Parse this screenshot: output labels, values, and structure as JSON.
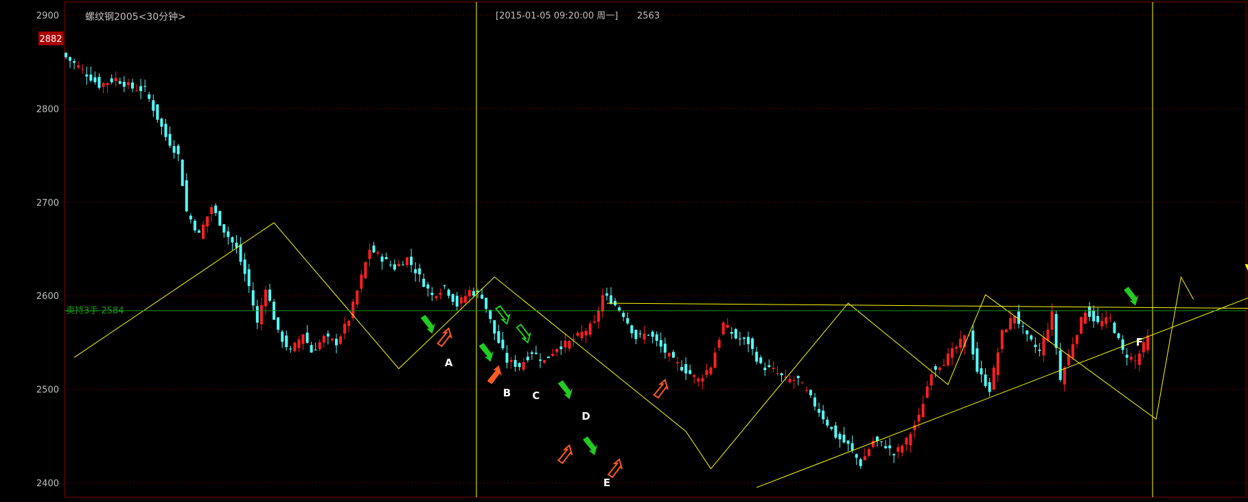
{
  "chart_title": "螺纹钢2005<30分钟>",
  "cursor_info": {
    "datetime": "[2015-01-05  09:20:00 周一]",
    "value": "2563"
  },
  "current_price_tag": "2882",
  "order_line": {
    "label": "卖持3手 2584",
    "price": 2584
  },
  "colors": {
    "background": "#000000",
    "up": "#ff2020",
    "down": "#54ffff",
    "axis": "#800000",
    "text": "#c0c0c0",
    "trend": "#ffff00",
    "order_line": "#1a9a1a",
    "tag_bg": "#aa0000",
    "arrow_green": "#22cc22",
    "arrow_orange": "#ff5a1f"
  },
  "chart_data": {
    "type": "candlestick",
    "yaxis": {
      "ticks": [
        2900,
        2800,
        2700,
        2600,
        2500,
        2400
      ],
      "ylim": [
        2390,
        2915
      ]
    },
    "x_bars": 262,
    "close_anchors": [
      [
        0,
        2855
      ],
      [
        3,
        2845
      ],
      [
        8,
        2825
      ],
      [
        12,
        2832
      ],
      [
        16,
        2822
      ],
      [
        19,
        2820
      ],
      [
        22,
        2790
      ],
      [
        24,
        2770
      ],
      [
        27,
        2750
      ],
      [
        29,
        2690
      ],
      [
        32,
        2665
      ],
      [
        35,
        2695
      ],
      [
        38,
        2670
      ],
      [
        41,
        2650
      ],
      [
        44,
        2610
      ],
      [
        46,
        2570
      ],
      [
        48,
        2610
      ],
      [
        51,
        2560
      ],
      [
        54,
        2540
      ],
      [
        57,
        2560
      ],
      [
        59,
        2540
      ],
      [
        62,
        2555
      ],
      [
        65,
        2550
      ],
      [
        68,
        2575
      ],
      [
        71,
        2620
      ],
      [
        73,
        2650
      ],
      [
        76,
        2640
      ],
      [
        79,
        2630
      ],
      [
        82,
        2640
      ],
      [
        85,
        2620
      ],
      [
        88,
        2600
      ],
      [
        91,
        2610
      ],
      [
        94,
        2590
      ],
      [
        97,
        2605
      ],
      [
        100,
        2600
      ],
      [
        103,
        2560
      ],
      [
        106,
        2530
      ],
      [
        109,
        2525
      ],
      [
        112,
        2540
      ],
      [
        115,
        2530
      ],
      [
        118,
        2545
      ],
      [
        121,
        2550
      ],
      [
        124,
        2560
      ],
      [
        127,
        2570
      ],
      [
        129,
        2600
      ],
      [
        131,
        2595
      ],
      [
        134,
        2580
      ],
      [
        137,
        2555
      ],
      [
        140,
        2560
      ],
      [
        143,
        2545
      ],
      [
        146,
        2530
      ],
      [
        149,
        2520
      ],
      [
        152,
        2510
      ],
      [
        155,
        2525
      ],
      [
        158,
        2570
      ],
      [
        161,
        2555
      ],
      [
        164,
        2550
      ],
      [
        167,
        2525
      ],
      [
        170,
        2520
      ],
      [
        173,
        2510
      ],
      [
        176,
        2510
      ],
      [
        179,
        2490
      ],
      [
        182,
        2470
      ],
      [
        185,
        2450
      ],
      [
        188,
        2440
      ],
      [
        191,
        2420
      ],
      [
        194,
        2445
      ],
      [
        197,
        2440
      ],
      [
        199,
        2430
      ],
      [
        202,
        2445
      ],
      [
        205,
        2470
      ],
      [
        208,
        2520
      ],
      [
        211,
        2530
      ],
      [
        214,
        2545
      ],
      [
        217,
        2560
      ],
      [
        219,
        2520
      ],
      [
        222,
        2500
      ],
      [
        225,
        2560
      ],
      [
        228,
        2580
      ],
      [
        231,
        2555
      ],
      [
        234,
        2540
      ],
      [
        237,
        2580
      ],
      [
        239,
        2510
      ],
      [
        242,
        2550
      ],
      [
        245,
        2585
      ],
      [
        248,
        2570
      ],
      [
        251,
        2575
      ],
      [
        254,
        2540
      ],
      [
        257,
        2530
      ],
      [
        260,
        2555
      ]
    ],
    "trend_lines": [
      [
        [
          2,
          2534
        ],
        [
          50,
          2678
        ],
        [
          80,
          2522
        ],
        [
          103,
          2620
        ],
        [
          149,
          2455
        ],
        [
          155,
          2415
        ],
        [
          188,
          2592
        ],
        [
          212,
          2505
        ],
        [
          221,
          2601
        ],
        [
          262,
          2468
        ],
        [
          268,
          2620
        ],
        [
          271,
          2596
        ]
      ],
      [
        [
          166,
          2395
        ],
        [
          310,
          2642
        ]
      ],
      [
        [
          130,
          2592
        ],
        [
          300,
          2586
        ]
      ]
    ],
    "annotations": [
      {
        "label": "A",
        "bar": 92,
        "price": 2545
      },
      {
        "label": "B",
        "bar": 106,
        "price": 2513
      },
      {
        "label": "C",
        "bar": 113,
        "price": 2510
      },
      {
        "label": "D",
        "bar": 125,
        "price": 2488
      },
      {
        "label": "E",
        "bar": 130,
        "price": 2417
      },
      {
        "label": "F",
        "bar": 258,
        "price": 2567
      }
    ],
    "arrows": [
      {
        "bar": 88,
        "price": 2560,
        "dir": "down",
        "color": "green",
        "filled": true
      },
      {
        "bar": 92,
        "price": 2565,
        "dir": "up",
        "color": "orange",
        "filled": false
      },
      {
        "bar": 102,
        "price": 2530,
        "dir": "down",
        "color": "green",
        "filled": true
      },
      {
        "bar": 104,
        "price": 2525,
        "dir": "up",
        "color": "orange",
        "filled": true
      },
      {
        "bar": 106,
        "price": 2570,
        "dir": "down",
        "color": "green",
        "filled": false
      },
      {
        "bar": 111,
        "price": 2550,
        "dir": "down",
        "color": "green",
        "filled": false
      },
      {
        "bar": 121,
        "price": 2490,
        "dir": "down",
        "color": "green",
        "filled": true
      },
      {
        "bar": 121,
        "price": 2440,
        "dir": "up",
        "color": "orange",
        "filled": false
      },
      {
        "bar": 127,
        "price": 2430,
        "dir": "down",
        "color": "green",
        "filled": true
      },
      {
        "bar": 133,
        "price": 2425,
        "dir": "up",
        "color": "orange",
        "filled": false
      },
      {
        "bar": 144,
        "price": 2510,
        "dir": "up",
        "color": "orange",
        "filled": false
      },
      {
        "bar": 257,
        "price": 2590,
        "dir": "down",
        "color": "green",
        "filled": true
      }
    ]
  }
}
